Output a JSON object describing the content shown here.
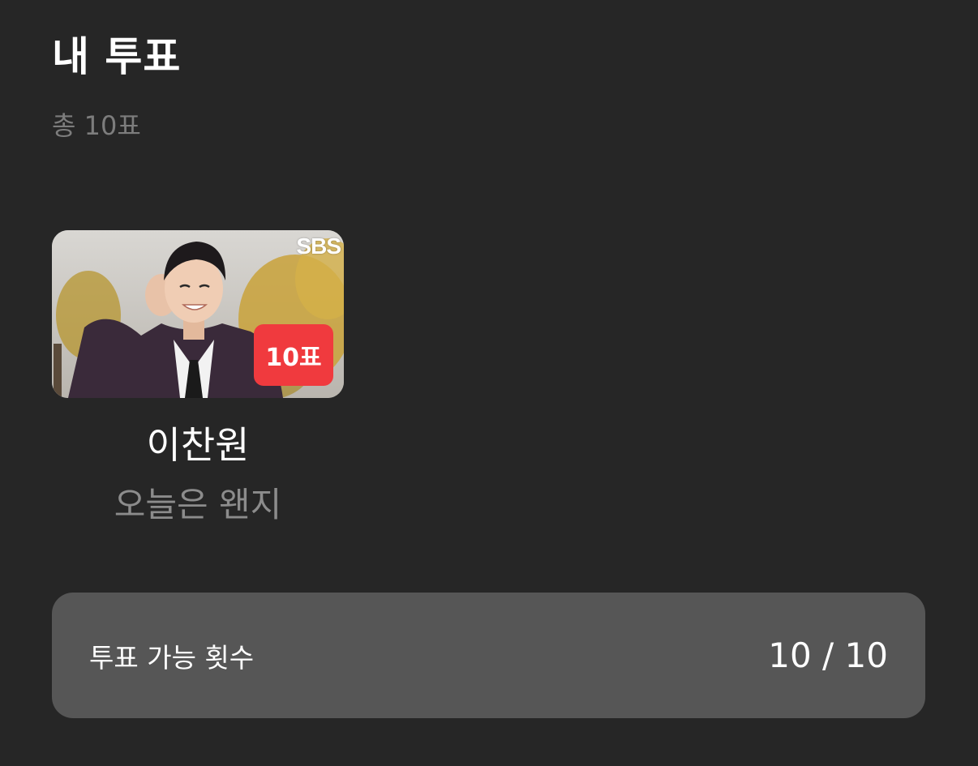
{
  "header": {
    "title": "내 투표",
    "total": "총 10표"
  },
  "vote_card": {
    "thumbnail": {
      "channel_logo": "SBS",
      "badge": "10표",
      "badge_color": "#f03a3e"
    },
    "name": "이찬원",
    "song": "오늘은 왠지"
  },
  "remaining": {
    "label": "투표 가능 횟수",
    "count": "10 / 10"
  },
  "colors": {
    "background": "#262626",
    "panel": "#565656",
    "muted_text": "#8c8c8c",
    "accent": "#f03a3e"
  }
}
